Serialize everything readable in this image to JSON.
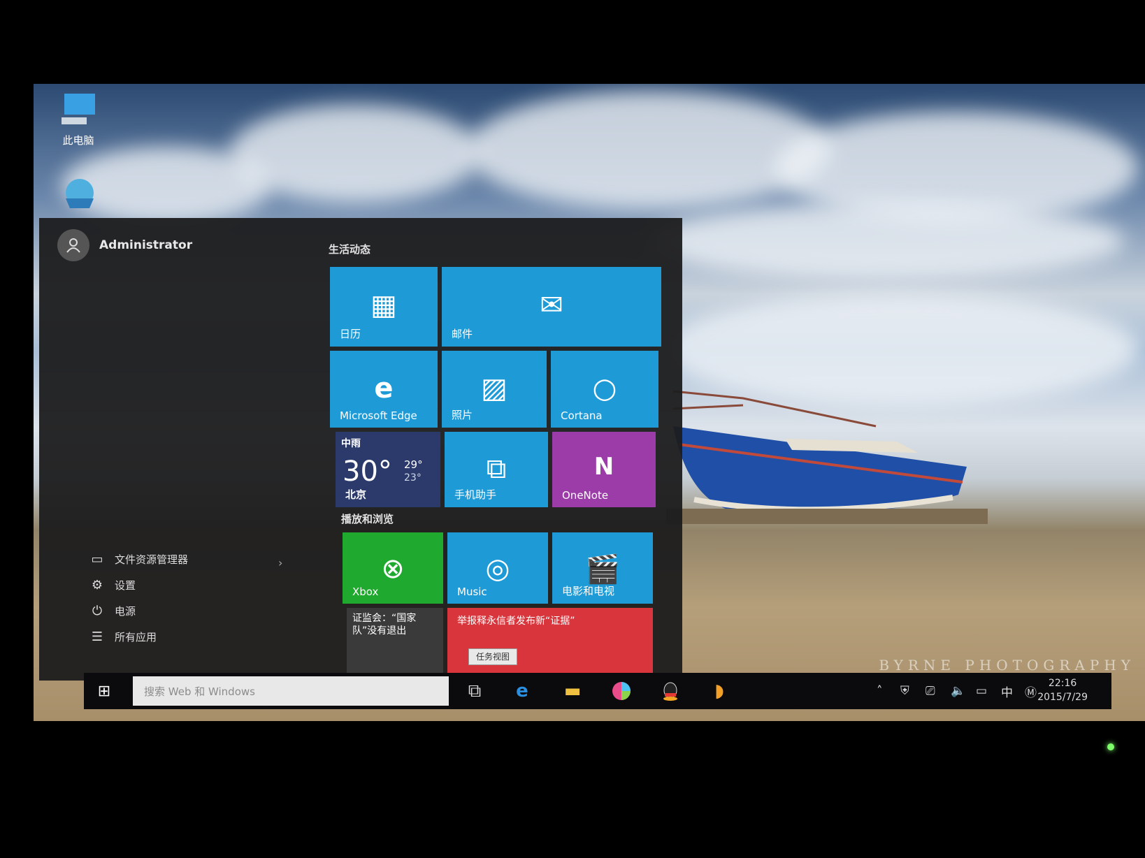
{
  "desktop": {
    "icons": [
      {
        "label": "此电脑",
        "icon": "this-pc-icon"
      },
      {
        "label": "",
        "icon": "network-globe-icon"
      }
    ],
    "watermark": "BYRNE PHOTOGRAPHY"
  },
  "start_menu": {
    "user": "Administrator",
    "bottom_items": [
      {
        "label": "文件资源管理器",
        "icon": "folder-icon"
      },
      {
        "label": "设置",
        "icon": "gear-icon"
      },
      {
        "label": "电源",
        "icon": "power-icon"
      },
      {
        "label": "所有应用",
        "icon": "list-icon"
      }
    ],
    "sections": {
      "life": "生活动态",
      "play": "播放和浏览"
    },
    "tiles": {
      "calendar": "日历",
      "mail": "邮件",
      "edge": "Microsoft Edge",
      "photos": "照片",
      "cortana": "Cortana",
      "weather": {
        "condition": "中雨",
        "temp": "30°",
        "high": "29°",
        "low": "23°",
        "city": "北京"
      },
      "phone": "手机助手",
      "onenote": "OneNote",
      "xbox": "Xbox",
      "music": "Music",
      "movies": "电影和电视",
      "news1": "证监会：“国家队”没有退出",
      "news2": "举报释永信者发布新“证据”",
      "tooltip": "任务视图"
    }
  },
  "taskbar": {
    "search_placeholder": "搜索 Web 和 Windows",
    "apps": [
      "task-view-icon",
      "edge-icon",
      "file-explorer-icon",
      "color-ball-icon",
      "qq-icon",
      "browser-icon"
    ],
    "tray": {
      "ime": "中",
      "time": "22:16",
      "date": "2015/7/29"
    }
  },
  "colors": {
    "tile_blue": "#1e9bd7",
    "xbox_green": "#1fa92f",
    "onenote_purple": "#9b3ca8",
    "news_red": "#d8363c",
    "weather_navy": "#2b3a6b"
  }
}
